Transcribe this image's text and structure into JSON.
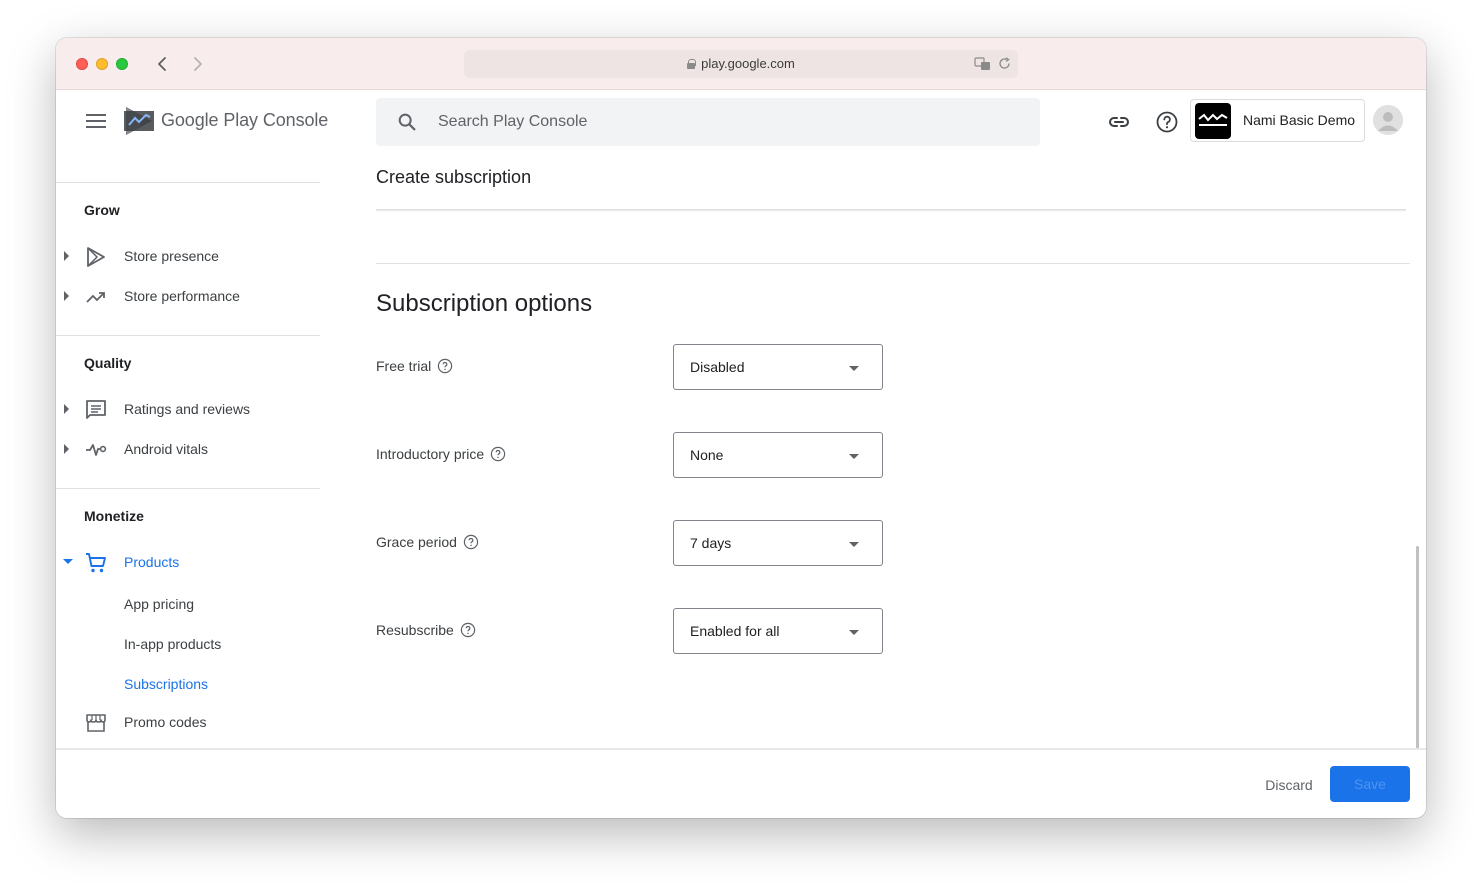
{
  "browser": {
    "url": "play.google.com"
  },
  "app": {
    "brand_primary": "Google Play",
    "brand_secondary": "Console",
    "search_placeholder": "Search Play Console",
    "selected_app": "Nami Basic Demo"
  },
  "sidebar": {
    "sections": [
      {
        "title": "Grow",
        "items": [
          {
            "label": "Store presence",
            "icon": "play-outline-icon"
          },
          {
            "label": "Store performance",
            "icon": "trending-up-icon"
          }
        ]
      },
      {
        "title": "Quality",
        "items": [
          {
            "label": "Ratings and reviews",
            "icon": "reviews-icon"
          },
          {
            "label": "Android vitals",
            "icon": "vitals-icon"
          }
        ]
      },
      {
        "title": "Monetize",
        "items": [
          {
            "label": "Products",
            "icon": "cart-icon",
            "expanded": true
          },
          {
            "label": "App pricing"
          },
          {
            "label": "In-app products"
          },
          {
            "label": "Subscriptions",
            "active": true
          },
          {
            "label": "Promo codes",
            "icon": "store-icon"
          }
        ]
      }
    ]
  },
  "page": {
    "title": "Create subscription",
    "section_heading": "Subscription options",
    "options": [
      {
        "label": "Free trial",
        "value": "Disabled"
      },
      {
        "label": "Introductory price",
        "value": "None"
      },
      {
        "label": "Grace period",
        "value": "7 days"
      },
      {
        "label": "Resubscribe",
        "value": "Enabled for all"
      }
    ]
  },
  "footer": {
    "discard_label": "Discard",
    "save_label": "Save"
  },
  "colors": {
    "accent": "#1a73e8",
    "titlebar": "#f8ecec"
  }
}
